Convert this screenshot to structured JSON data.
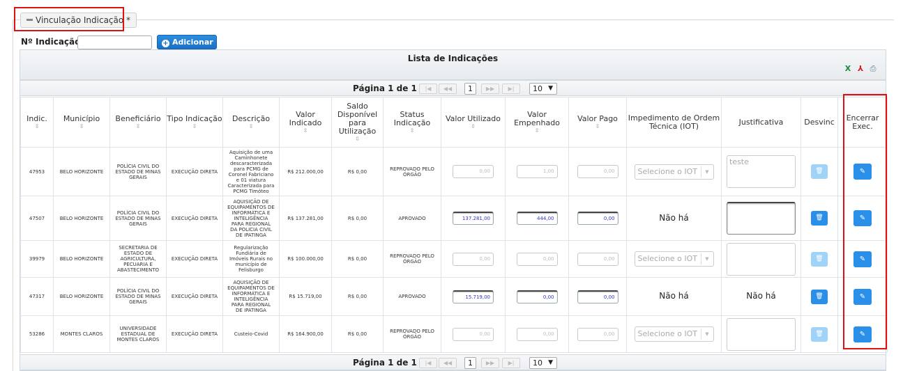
{
  "fieldset": {
    "legend": "Vinculação Indicação *"
  },
  "form": {
    "indicacao_label": "Nº Indicação:",
    "indicacao_value": "",
    "add_button": "Adicionar"
  },
  "grid": {
    "caption": "Lista de Indicações",
    "export_icons": [
      "excel-icon",
      "pdf-icon",
      "print-icon"
    ],
    "pager": {
      "text": "Página 1 de 1",
      "current_page": "1",
      "page_size": "10",
      "first": "|◀",
      "prev": "◀◀",
      "next": "▶▶",
      "last": "▶|"
    },
    "columns": [
      {
        "label": "Indic.",
        "sortable": true
      },
      {
        "label": "Município",
        "sortable": true
      },
      {
        "label": "Beneficiário",
        "sortable": true
      },
      {
        "label": "Tipo Indicação",
        "sortable": true
      },
      {
        "label": "Descrição",
        "sortable": true
      },
      {
        "label": "Valor Indicado",
        "sortable": true
      },
      {
        "label": "Saldo Disponível para Utilização",
        "sortable": true
      },
      {
        "label": "Status Indicação",
        "sortable": true
      },
      {
        "label": "Valor Utilizado",
        "sortable": true
      },
      {
        "label": "Valor Empenhado",
        "sortable": true
      },
      {
        "label": "Valor Pago",
        "sortable": true
      },
      {
        "label": "Impedimento de Ordem Técnica (IOT)",
        "sortable": false
      },
      {
        "label": "Justificativa",
        "sortable": false
      },
      {
        "label": "Desvinc",
        "sortable": false
      },
      {
        "label": "Encerrar Exec.",
        "sortable": false
      }
    ],
    "rows": [
      {
        "indic": "47953",
        "municipio": "BELO HORIZONTE",
        "beneficiario": "POLÍCIA CIVIL DO ESTADO DE MINAS GERAIS",
        "tipo": "EXECUÇÃO DIRETA",
        "descricao": "Aquisição de uma Caminhonete descaracterizada para PCMG de Coronel Fabriciano e 01 viatura Caracterizada para PCMG Timóteo",
        "valor_indicado": "R$ 212.000,00",
        "saldo": "R$ 0,00",
        "status": "REPROVADO PELO ÓRGÃO",
        "valor_utilizado": "0,00",
        "valor_empenhado": "1,00",
        "valor_pago": "0,00",
        "iot": "Selecione o IOT",
        "justificativa": "teste",
        "editable": false
      },
      {
        "indic": "47507",
        "municipio": "BELO HORIZONTE",
        "beneficiario": "POLÍCIA CIVIL DO ESTADO DE MINAS GERAIS",
        "tipo": "EXECUÇÃO DIRETA",
        "descricao": "AQUISIÇÃO DE EQUIPAMENTOS DE INFORMÁTICA E INTELIGÊNCIA PARA REGIONAL DA POLICIA CIVIL DE IPATINGA",
        "valor_indicado": "R$ 137.281,00",
        "saldo": "R$ 0,00",
        "status": "APROVADO",
        "valor_utilizado": "137.281,00",
        "valor_empenhado": "444,00",
        "valor_pago": "0,00",
        "iot": "Não há",
        "justificativa": "",
        "editable": true
      },
      {
        "indic": "39979",
        "municipio": "BELO HORIZONTE",
        "beneficiario": "SECRETARIA DE ESTADO DE AGRICULTURA, PECUARIA E ABASTECIMENTO",
        "tipo": "EXECUÇÃO DIRETA",
        "descricao": "Regularização Fundiária de Imóveis Rurais no município de Felisburgo",
        "valor_indicado": "R$ 100.000,00",
        "saldo": "R$ 0,00",
        "status": "REPROVADO PELO ÓRGÃO",
        "valor_utilizado": "0,00",
        "valor_empenhado": "0,00",
        "valor_pago": "0,00",
        "iot": "Selecione o IOT",
        "justificativa": "",
        "editable": false
      },
      {
        "indic": "47317",
        "municipio": "BELO HORIZONTE",
        "beneficiario": "POLÍCIA CIVIL DO ESTADO DE MINAS GERAIS",
        "tipo": "EXECUÇÃO DIRETA",
        "descricao": "AQUISIÇÃO DE EQUIPAMENTOS DE INFORMÁTICA E INTELIGÊNCIA PARA REGIONAL DE IPATINGA",
        "valor_indicado": "R$ 15.719,00",
        "saldo": "R$ 0,00",
        "status": "APROVADO",
        "valor_utilizado": "15.719,00",
        "valor_empenhado": "0,00",
        "valor_pago": "0,00",
        "iot": "Não há",
        "justificativa": "Não há",
        "editable": true
      },
      {
        "indic": "53286",
        "municipio": "MONTES CLAROS",
        "beneficiario": "UNIVERSIDADE ESTADUAL DE MONTES CLAROS",
        "tipo": "EXECUÇÃO DIRETA",
        "descricao": "Custeio-Covid",
        "valor_indicado": "R$ 164.900,00",
        "saldo": "R$ 0,00",
        "status": "REPROVADO PELO ÓRGÃO",
        "valor_utilizado": "0,00",
        "valor_empenhado": "0,00",
        "valor_pago": "0,00",
        "iot": "Selecione o IOT",
        "justificativa": "",
        "editable": false
      }
    ]
  }
}
